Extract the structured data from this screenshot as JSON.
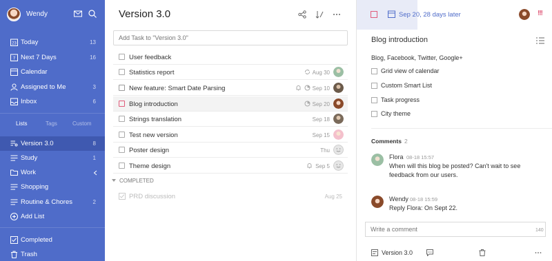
{
  "sidebar": {
    "user_name": "Wendy",
    "items": [
      {
        "label": "Today",
        "count": "13",
        "icon": "calendar-day-icon"
      },
      {
        "label": "Next 7 Days",
        "count": "16",
        "icon": "calendar-week-icon"
      },
      {
        "label": "Calendar",
        "count": "",
        "icon": "calendar-icon"
      },
      {
        "label": "Assigned to Me",
        "count": "3",
        "icon": "user-icon"
      },
      {
        "label": "Inbox",
        "count": "6",
        "icon": "inbox-icon"
      }
    ],
    "tabs": [
      "Lists",
      "Tags",
      "Custom"
    ],
    "lists": [
      {
        "label": "Version 3.0",
        "count": "8",
        "icon": "shared-list-icon"
      },
      {
        "label": "Study",
        "count": "1",
        "icon": "list-icon"
      },
      {
        "label": "Work",
        "count": "",
        "icon": "folder-icon"
      },
      {
        "label": "Shopping",
        "count": "",
        "icon": "list-icon"
      },
      {
        "label": "Routine & Chores",
        "count": "2",
        "icon": "list-icon"
      }
    ],
    "add_list": "Add List",
    "completed": "Completed",
    "trash": "Trash"
  },
  "main": {
    "title": "Version 3.0",
    "add_placeholder": "Add Task to \"Version 3.0\"",
    "tasks": [
      {
        "title": "User feedback",
        "date": ""
      },
      {
        "title": "Statistics report",
        "date": "Aug 30"
      },
      {
        "title": "New feature: Smart Date Parsing",
        "date": "Sep 10"
      },
      {
        "title": "Blog introduction",
        "date": "Sep 20"
      },
      {
        "title": "Strings translation",
        "date": "Sep 18"
      },
      {
        "title": "Test new version",
        "date": "Sep 15"
      },
      {
        "title": "Poster design",
        "date": "Thu"
      },
      {
        "title": "Theme design",
        "date": "Sep 5"
      }
    ],
    "completed_header": "COMPLETED",
    "completed_tasks": [
      {
        "title": "PRD discussion",
        "date": "Aug 25"
      }
    ]
  },
  "detail": {
    "due": "Sep 20, 28 days later",
    "priority": "!!!",
    "title": "Blog introduction",
    "description": "Blog, Facebook, Twitter, Google+",
    "checklist": [
      "Grid view of calendar",
      "Custom Smart List",
      "Task progress",
      "City theme"
    ],
    "comments_label": "Comments",
    "comments_count": "2",
    "comments": [
      {
        "name": "Flora",
        "time": "08-18 15:57",
        "text": "When will this blog be posted? Can't wait to see feedback from our users."
      },
      {
        "name": "Wendy",
        "time": "08-18 15:59",
        "text": "Reply Flora: On Sept 22."
      }
    ],
    "comment_placeholder": "Write a comment",
    "comment_limit": "140",
    "footer_list": "Version 3.0"
  },
  "colors": {
    "sidebar": "#4f6cc9",
    "accent": "#4f6cc9",
    "priority": "#e05a7a"
  }
}
